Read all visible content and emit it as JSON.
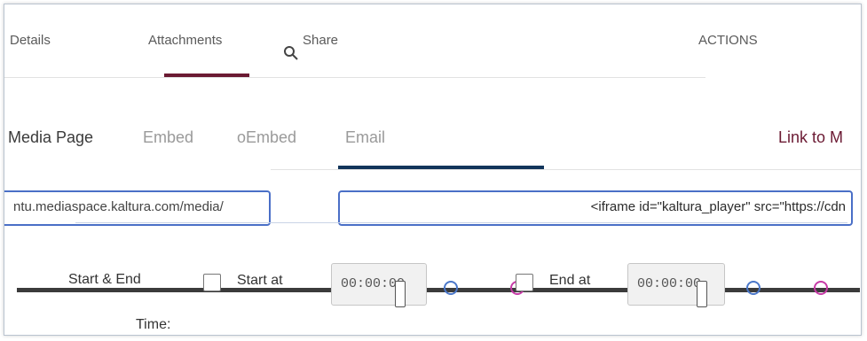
{
  "top_tabs": [
    {
      "label": "Details"
    },
    {
      "label": "Attachments"
    },
    {
      "label": "Share"
    },
    {
      "label": "ACTIONS"
    }
  ],
  "share_tabs": [
    {
      "label": "Media Page"
    },
    {
      "label": "Embed"
    },
    {
      "label": "oEmbed"
    },
    {
      "label": "Email"
    },
    {
      "label": "Link to M"
    }
  ],
  "link_field": {
    "value": "ntu.mediaspace.kaltura.com/media/"
  },
  "embed_field": {
    "value": "<iframe id=\"kaltura_player\" src=\"https://cdn"
  },
  "start_end": {
    "label": "Start & End",
    "time_label": "Time:",
    "start_label": "Start at",
    "end_label": "End at",
    "start_time": "00:00:00",
    "end_time": "00:00:00"
  },
  "colors": {
    "accent_tab": "#6b1a33",
    "share_underline": "#12355b",
    "input_border": "#4a6fc7"
  }
}
